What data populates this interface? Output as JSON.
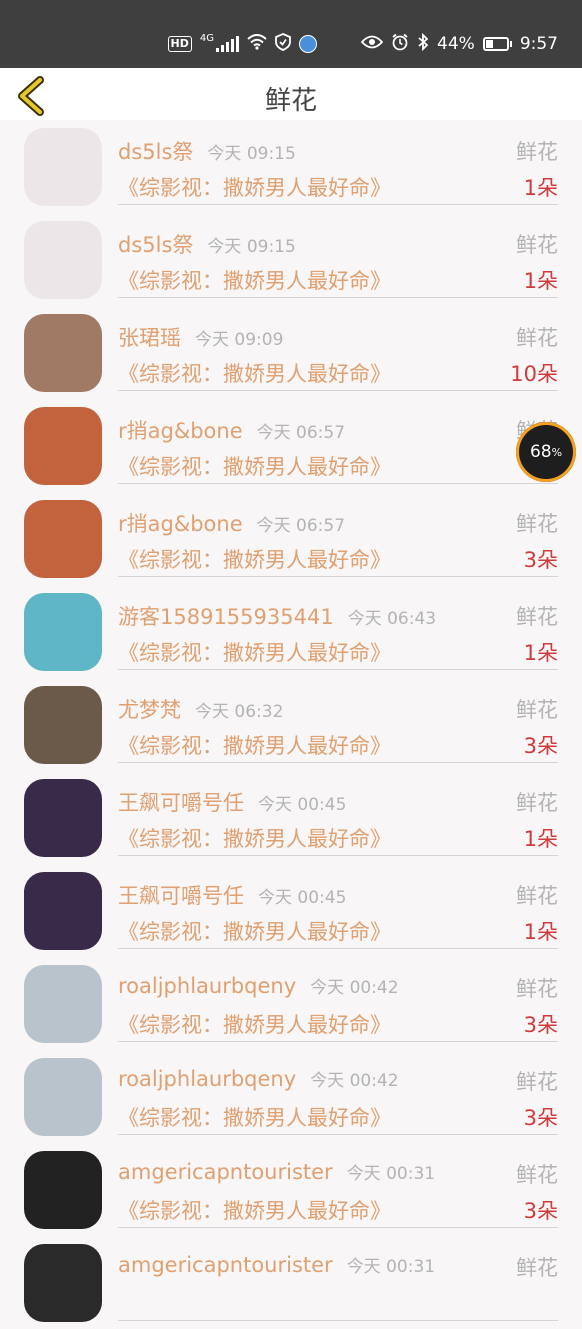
{
  "status": {
    "hd": "HD",
    "net": "4G",
    "battery_level": 44,
    "battery": "44%",
    "time": "9:57"
  },
  "header": {
    "title": "鲜花"
  },
  "overlay": {
    "percent": "68",
    "unit": "%"
  },
  "avatar_colors": [
    "#ece6e8",
    "#ece6e8",
    "#a07a64",
    "#c2633d",
    "#c2633d",
    "#5fb6c6",
    "#6b5a4a",
    "#3a2a4a",
    "#3a2a4a",
    "#b9c3cc",
    "#b9c3cc",
    "#222222",
    "#2a2a2a"
  ],
  "rows": [
    {
      "name": "ds5ls祭",
      "time": "今天 09:15",
      "kind": "鲜花",
      "book": "《综影视：撒娇男人最好命》",
      "count": "1朵"
    },
    {
      "name": "ds5ls祭",
      "time": "今天 09:15",
      "kind": "鲜花",
      "book": "《综影视：撒娇男人最好命》",
      "count": "1朵"
    },
    {
      "name": "张珺瑶",
      "time": "今天 09:09",
      "kind": "鲜花",
      "book": "《综影视：撒娇男人最好命》",
      "count": "10朵"
    },
    {
      "name": "r捎ag&bone",
      "time": "今天 06:57",
      "kind": "鲜花",
      "book": "《综影视：撒娇男人最好命》",
      "count": ""
    },
    {
      "name": "r捎ag&bone",
      "time": "今天 06:57",
      "kind": "鲜花",
      "book": "《综影视：撒娇男人最好命》",
      "count": "3朵"
    },
    {
      "name": "游客1589155935441",
      "time": "今天 06:43",
      "kind": "鲜花",
      "book": "《综影视：撒娇男人最好命》",
      "count": "1朵"
    },
    {
      "name": "尤梦梵",
      "time": "今天 06:32",
      "kind": "鲜花",
      "book": "《综影视：撒娇男人最好命》",
      "count": "3朵"
    },
    {
      "name": "王飙可嚼号任",
      "time": "今天 00:45",
      "kind": "鲜花",
      "book": "《综影视：撒娇男人最好命》",
      "count": "1朵"
    },
    {
      "name": "王飙可嚼号任",
      "time": "今天 00:45",
      "kind": "鲜花",
      "book": "《综影视：撒娇男人最好命》",
      "count": "1朵"
    },
    {
      "name": "roaljphlaurbqeny",
      "time": "今天 00:42",
      "kind": "鲜花",
      "book": "《综影视：撒娇男人最好命》",
      "count": "3朵"
    },
    {
      "name": "roaljphlaurbqeny",
      "time": "今天 00:42",
      "kind": "鲜花",
      "book": "《综影视：撒娇男人最好命》",
      "count": "3朵"
    },
    {
      "name": "amgericapntourister",
      "time": "今天 00:31",
      "kind": "鲜花",
      "book": "《综影视：撒娇男人最好命》",
      "count": "3朵"
    },
    {
      "name": "amgericapntourister",
      "time": "今天 00:31",
      "kind": "鲜花",
      "book": "",
      "count": ""
    }
  ]
}
